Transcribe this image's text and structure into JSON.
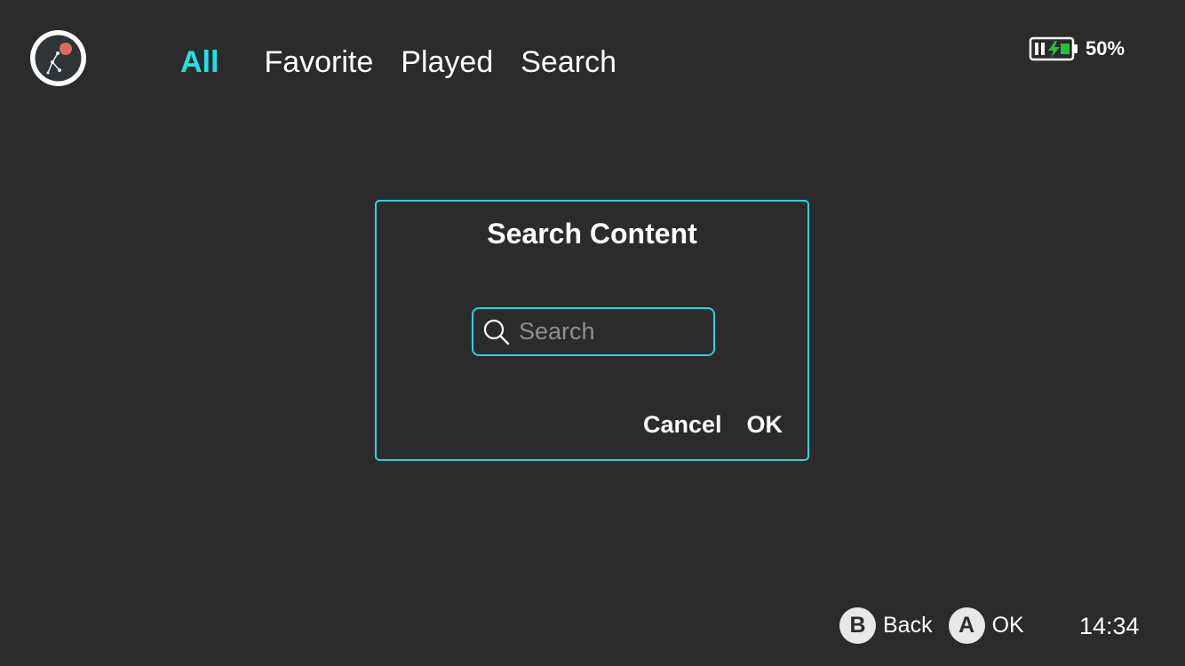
{
  "header": {
    "tabs": [
      {
        "label": "All",
        "active": true
      },
      {
        "label": "Favorite",
        "active": false
      },
      {
        "label": "Played",
        "active": false
      },
      {
        "label": "Search",
        "active": false
      }
    ],
    "battery": {
      "percent_label": "50%",
      "charging": true,
      "icon": "battery-charging-icon"
    },
    "avatar_icon": "user-avatar-icon"
  },
  "dialog": {
    "title": "Search Content",
    "search": {
      "placeholder": "Search",
      "value": "",
      "icon": "search-icon"
    },
    "cancel_label": "Cancel",
    "ok_label": "OK"
  },
  "footer": {
    "hints": [
      {
        "button": "B",
        "label": "Back"
      },
      {
        "button": "A",
        "label": "OK"
      }
    ],
    "clock": "14:34"
  },
  "colors": {
    "accent": "#1de3e6",
    "dialog_border": "#2ad3dc",
    "background": "#2b2b2b",
    "battery_bolt": "#22c33a"
  }
}
